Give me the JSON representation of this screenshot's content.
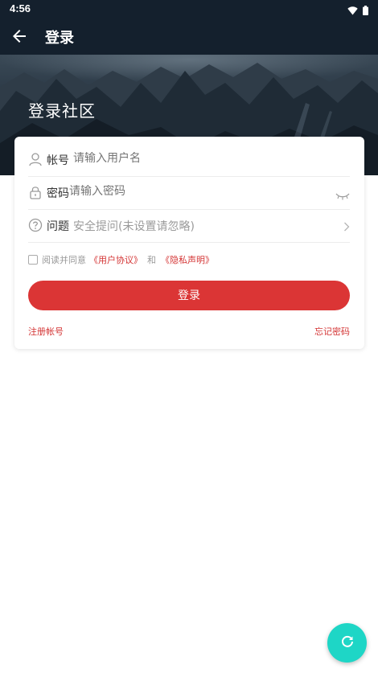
{
  "status_bar": {
    "time": "4:56",
    "icons": [
      "wifi-icon",
      "battery-icon"
    ]
  },
  "app_bar": {
    "back_icon": "arrow-left-icon",
    "title": "登录"
  },
  "banner": {
    "title": "登录社区"
  },
  "form": {
    "account": {
      "label": "帐号",
      "placeholder": "请输入用户名",
      "icon": "user-icon"
    },
    "password": {
      "label": "密码",
      "placeholder": "请输入密码",
      "icon": "lock-icon",
      "toggle_icon": "eye-closed-icon"
    },
    "question": {
      "label": "问题",
      "value": "安全提问(未设置请忽略)",
      "icon": "question-circle-icon",
      "trail_icon": "chevron-right-icon"
    },
    "agreement": {
      "prefix": "阅读并同意",
      "user_agreement": "《用户协议》",
      "conjunction": "和",
      "privacy_policy": "《隐私声明》"
    },
    "login_button": "登录",
    "register_link": "注册帐号",
    "forgot_link": "忘记密码"
  },
  "fab": {
    "icon": "refresh-icon"
  },
  "colors": {
    "header_bg": "#14202d",
    "accent_red": "#db3535",
    "fab_teal": "#1ed6c6"
  }
}
